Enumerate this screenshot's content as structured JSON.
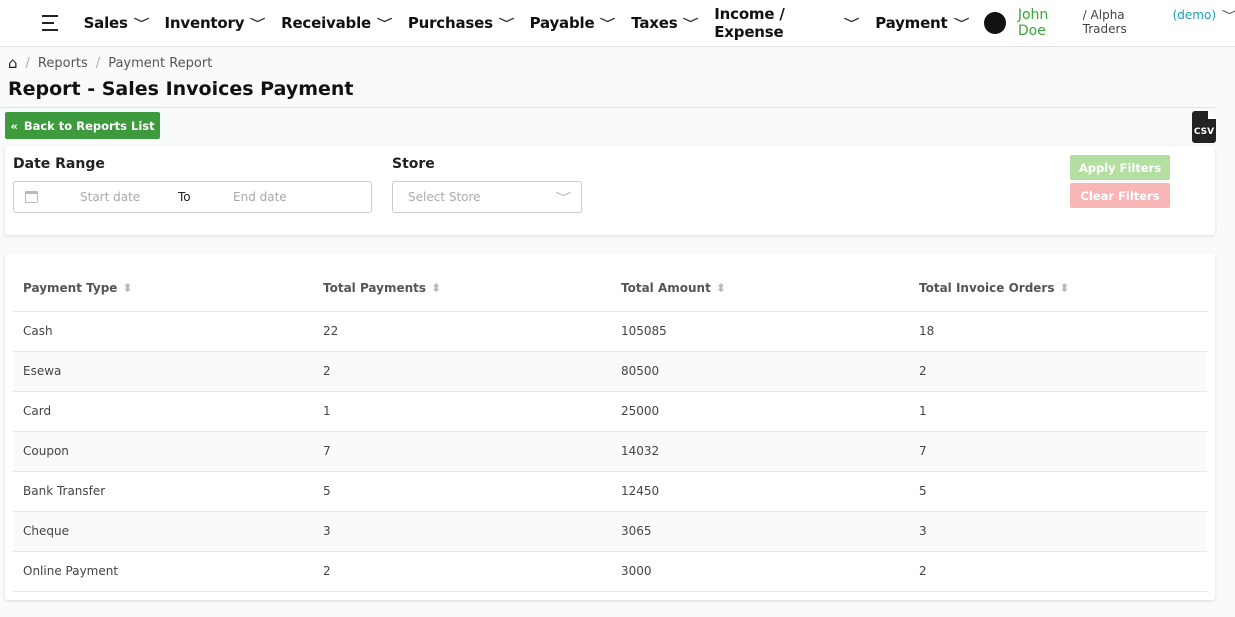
{
  "nav": {
    "items": [
      "Sales",
      "Inventory",
      "Receivable",
      "Purchases",
      "Payable",
      "Taxes",
      "Income / Expense",
      "Payment"
    ],
    "user_name": "John Doe",
    "company": "/ Alpha Traders",
    "demo": "(demo)"
  },
  "breadcrumb": [
    "Reports",
    "Payment Report"
  ],
  "page_title": "Report - Sales Invoices Payment",
  "back_label": "Back to Reports List",
  "csv_label": "CSV",
  "filters": {
    "date_range_label": "Date Range",
    "start_placeholder": "Start date",
    "to_label": "To",
    "end_placeholder": "End date",
    "store_label": "Store",
    "store_placeholder": "Select Store",
    "apply_label": "Apply Filters",
    "clear_label": "Clear Filters"
  },
  "table": {
    "headers": [
      "Payment Type",
      "Total Payments",
      "Total Amount",
      "Total Invoice Orders"
    ],
    "rows": [
      [
        "Cash",
        "22",
        "105085",
        "18"
      ],
      [
        "Esewa",
        "2",
        "80500",
        "2"
      ],
      [
        "Card",
        "1",
        "25000",
        "1"
      ],
      [
        "Coupon",
        "7",
        "14032",
        "7"
      ],
      [
        "Bank Transfer",
        "5",
        "12450",
        "5"
      ],
      [
        "Cheque",
        "3",
        "3065",
        "3"
      ],
      [
        "Online Payment",
        "2",
        "3000",
        "2"
      ]
    ]
  }
}
